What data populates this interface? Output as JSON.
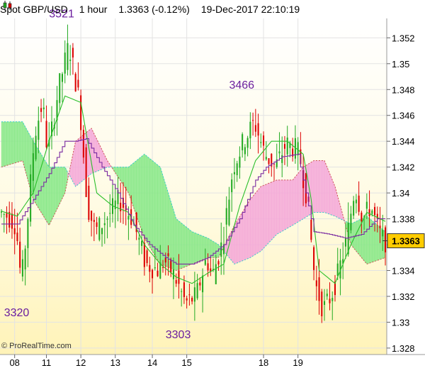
{
  "header": {
    "instrument": "Spot GBP/USD",
    "timeframe": "1 hour",
    "quote": "1.3363 (-0.12%)",
    "datetime": "19-Dec-2017 22:10:19"
  },
  "footer": {
    "copyright": "© ProRealTime.com"
  },
  "colors": {
    "up_candle": "#22aa22",
    "down_candle": "#dd0000",
    "kumo_bull": "#88e888",
    "kumo_bear": "#f4a8d8",
    "tenkan": "#2bbf2b",
    "kijun": "#7a2aa0",
    "span_a": "#33cccc",
    "span_b": "#cc5555",
    "last_price_tag": "#ffcc00",
    "annotation": "#6a1e9e"
  },
  "chart_data": {
    "type": "candlestick",
    "title": "Spot GBP/USD 1 hour",
    "ylim": [
      1.3275,
      1.3535
    ],
    "y_ticks": [
      1.328,
      1.33,
      1.332,
      1.334,
      1.336,
      1.338,
      1.34,
      1.342,
      1.344,
      1.346,
      1.348,
      1.35,
      1.352
    ],
    "x_tick_labels": [
      "08",
      "11",
      "12",
      "13",
      "14",
      "15",
      "18",
      "19"
    ],
    "last_price": "1.3363",
    "annotations": [
      {
        "label": "3521",
        "price": 1.3521
      },
      {
        "label": "3466",
        "price": 1.3466
      },
      {
        "label": "3320",
        "price": 1.332
      },
      {
        "label": "3303",
        "price": 1.3303
      }
    ],
    "price_path": {
      "x_index": [
        0,
        3,
        6,
        8,
        10,
        13,
        16,
        18,
        22,
        26,
        30,
        33,
        36,
        40,
        45,
        50,
        55,
        60,
        62,
        66,
        70,
        74,
        78,
        80,
        84,
        88,
        92,
        96,
        100,
        104,
        108,
        111,
        113,
        116,
        119,
        122,
        125,
        128,
        131,
        134,
        137,
        140,
        143,
        145
      ],
      "close": [
        1.3385,
        1.3382,
        1.3375,
        1.333,
        1.337,
        1.3445,
        1.347,
        1.343,
        1.348,
        1.3515,
        1.347,
        1.339,
        1.337,
        1.338,
        1.3395,
        1.338,
        1.3345,
        1.334,
        1.3348,
        1.3335,
        1.3315,
        1.332,
        1.335,
        1.3335,
        1.3362,
        1.342,
        1.344,
        1.3455,
        1.343,
        1.342,
        1.3438,
        1.3435,
        1.343,
        1.3395,
        1.333,
        1.331,
        1.332,
        1.334,
        1.3365,
        1.3405,
        1.338,
        1.339,
        1.337,
        1.3363
      ]
    },
    "tenkan": {
      "x_index": [
        0,
        6,
        12,
        18,
        24,
        30,
        36,
        42,
        48,
        54,
        60,
        66,
        72,
        78,
        84,
        90,
        96,
        102,
        108,
        114,
        117,
        120,
        126,
        132,
        138,
        145
      ],
      "values": [
        1.3386,
        1.3382,
        1.34,
        1.344,
        1.3475,
        1.347,
        1.34,
        1.339,
        1.3385,
        1.336,
        1.3345,
        1.3335,
        1.333,
        1.3338,
        1.3345,
        1.339,
        1.3425,
        1.344,
        1.344,
        1.343,
        1.3395,
        1.334,
        1.333,
        1.336,
        1.3385,
        1.3378
      ]
    },
    "kijun": {
      "x_index": [
        0,
        6,
        12,
        18,
        24,
        28,
        32,
        38,
        44,
        50,
        56,
        62,
        66,
        72,
        78,
        84,
        90,
        96,
        100,
        106,
        112,
        118,
        124,
        130,
        136,
        142,
        145
      ],
      "values": [
        1.3376,
        1.3376,
        1.3395,
        1.3415,
        1.344,
        1.344,
        1.3442,
        1.342,
        1.34,
        1.3375,
        1.336,
        1.335,
        1.3345,
        1.3345,
        1.335,
        1.336,
        1.338,
        1.341,
        1.342,
        1.3428,
        1.343,
        1.337,
        1.3368,
        1.3365,
        1.3368,
        1.338,
        1.338
      ]
    },
    "kumo_span_a": {
      "x_index": [
        0,
        8,
        12,
        18,
        24,
        28,
        34,
        40,
        48,
        54,
        60,
        66,
        72,
        78,
        82,
        88,
        94,
        98,
        104,
        110,
        114,
        118,
        122,
        126,
        132,
        138,
        145
      ],
      "values": [
        1.3455,
        1.3455,
        1.344,
        1.342,
        1.342,
        1.3405,
        1.3415,
        1.342,
        1.342,
        1.343,
        1.342,
        1.338,
        1.337,
        1.3365,
        1.336,
        1.3345,
        1.335,
        1.3355,
        1.3368,
        1.3375,
        1.338,
        1.3385,
        1.3385,
        1.3382,
        1.3376,
        1.3382,
        1.337
      ]
    },
    "kumo_span_b": {
      "x_index": [
        0,
        8,
        12,
        18,
        24,
        28,
        34,
        40,
        48,
        54,
        60,
        66,
        72,
        78,
        82,
        88,
        94,
        98,
        104,
        110,
        114,
        118,
        122,
        126,
        132,
        138,
        145
      ],
      "values": [
        1.342,
        1.3425,
        1.3395,
        1.3375,
        1.34,
        1.344,
        1.345,
        1.3425,
        1.34,
        1.3365,
        1.3345,
        1.334,
        1.3345,
        1.335,
        1.335,
        1.3375,
        1.3395,
        1.3405,
        1.341,
        1.341,
        1.342,
        1.3425,
        1.3425,
        1.3405,
        1.336,
        1.3345,
        1.335
      ]
    }
  }
}
